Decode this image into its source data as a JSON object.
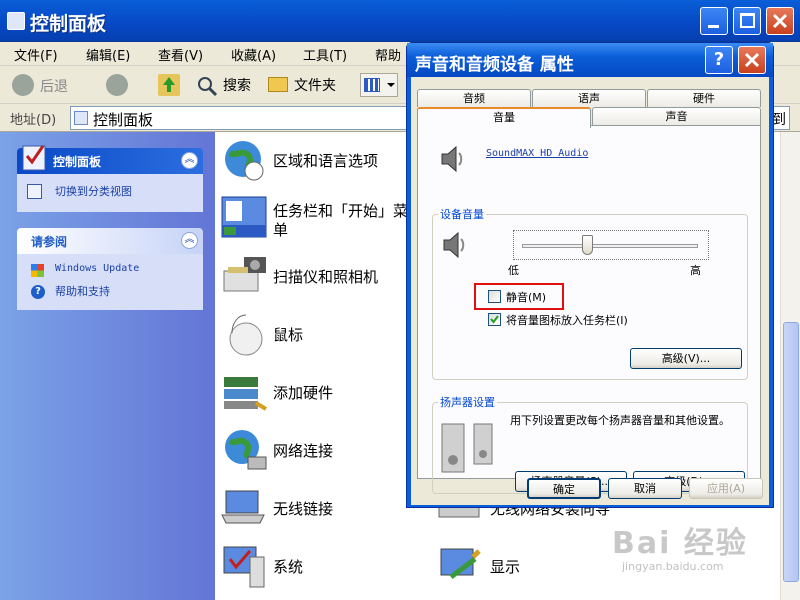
{
  "window": {
    "title": "控制面板",
    "menu": [
      "文件(F)",
      "编辑(E)",
      "查看(V)",
      "收藏(A)",
      "工具(T)",
      "帮助"
    ],
    "toolbar": {
      "back": "后退",
      "search": "搜索",
      "folders": "文件夹"
    },
    "address_label": "地址(D)",
    "address_value": "控制面板",
    "go_label": "到"
  },
  "left_pane": {
    "panel1_title": "控制面板",
    "panel1_link": "切换到分类视图",
    "panel2_title": "请参阅",
    "panel2_links": [
      "Windows Update",
      "帮助和支持"
    ]
  },
  "items": [
    {
      "label": "区域和语言选项",
      "icon": "globe-clock-icon"
    },
    {
      "label": "任务栏和「开始」菜",
      "label2": "单",
      "icon": "taskbar-icon"
    },
    {
      "label": "扫描仪和照相机",
      "icon": "scanner-camera-icon"
    },
    {
      "label": "鼠标",
      "icon": "mouse-icon"
    },
    {
      "label": "添加硬件",
      "icon": "add-hardware-icon"
    },
    {
      "label": "网络连接",
      "icon": "network-globe-icon"
    },
    {
      "label": "无线链接",
      "icon": "wireless-laptop-icon"
    },
    {
      "label": "系统",
      "icon": "system-monitor-icon"
    }
  ],
  "items_col2": [
    {
      "label": "无线网络安装向导",
      "icon": "wireless-wizard-icon"
    },
    {
      "label": "显示",
      "icon": "display-icon"
    }
  ],
  "dialog": {
    "title": "声音和音频设备 属性",
    "tabs_back": [
      "音频",
      "语声",
      "硬件"
    ],
    "tabs_front": [
      "音量",
      "声音"
    ],
    "device_name": "SoundMAX HD Audio",
    "device_volume_title": "设备音量",
    "slider_low": "低",
    "slider_high": "高",
    "slider_level": 0.37,
    "mute_label": "静音(M)",
    "mute_checked": false,
    "tray_label": "将音量图标放入任务栏(I)",
    "tray_checked": true,
    "advanced1": "高级(V)...",
    "speaker_title": "扬声器设置",
    "speaker_desc": "用下列设置更改每个扬声器音量和其他设置。",
    "speaker_volume_btn": "扬声器音量(S)...",
    "advanced2": "高级(D)...",
    "ok": "确定",
    "cancel": "取消",
    "apply": "应用(A)"
  },
  "watermark": {
    "line1": "Bai 经验",
    "line2": "jingyan.baidu.com"
  },
  "colors": {
    "highlight_box": "#e01010",
    "link": "#1a3ea8"
  }
}
